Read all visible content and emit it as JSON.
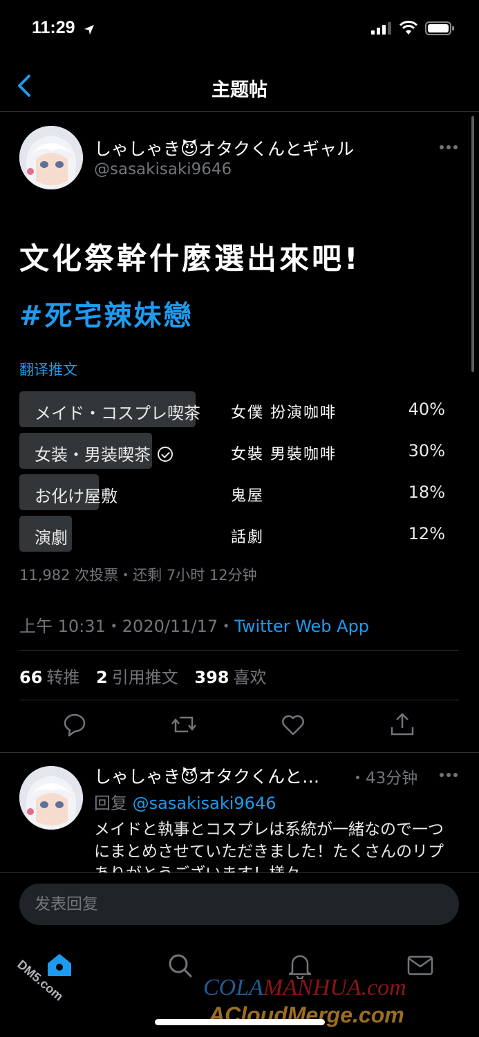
{
  "status_bar": {
    "time": "11:29"
  },
  "nav": {
    "title": "主题帖"
  },
  "tweet": {
    "display_name": "しゃしゃき😈オタクくんとギャル",
    "handle": "@sasakisaki9646",
    "text": "文化祭幹什麼選出來吧!",
    "hashtag": "#死宅辣妹戀",
    "translate_label": "翻译推文",
    "poll": {
      "options": [
        {
          "label": "メイド・コスプレ喫茶",
          "translation": "女僕 扮演咖啡",
          "percent": "40%",
          "value": 40,
          "selected": false
        },
        {
          "label": "女装・男装喫茶",
          "translation": "女裝 男裝咖啡",
          "percent": "30%",
          "value": 30,
          "selected": true
        },
        {
          "label": "お化け屋敷",
          "translation": "鬼屋",
          "percent": "18%",
          "value": 18,
          "selected": false
        },
        {
          "label": "演劇",
          "translation": "話劇",
          "percent": "12%",
          "value": 12,
          "selected": false
        }
      ],
      "meta": "11,982 次投票・还剩 7小时 12分钟"
    },
    "timestamp": "上午 10:31・2020/11/17・",
    "source": "Twitter Web App",
    "stats": {
      "retweets_count": "66",
      "retweets_label": "转推",
      "quotes_count": "2",
      "quotes_label": "引用推文",
      "likes_count": "398",
      "likes_label": "喜欢"
    }
  },
  "reply": {
    "display_name": "しゃしゃき😈オタクくんと…",
    "time": "・43分钟",
    "reply_to_label": "回复",
    "reply_to_handle": "@sasakisaki9646",
    "text": "メイドと執事とコスプレは系統が一緒なので一つにまとめさせていただきました！たくさんのリプありがとうございます！様々"
  },
  "composer": {
    "placeholder": "发表回复"
  },
  "watermarks": {
    "left": "DM5.com",
    "right_line1_a": "COLA",
    "right_line1_b": "MANHUA.com",
    "right_line2": "ACloudMerge.com"
  },
  "colors": {
    "accent": "#1d9bf0",
    "background": "#000000",
    "secondary_text": "#71767b",
    "poll_bar": "#333639"
  }
}
